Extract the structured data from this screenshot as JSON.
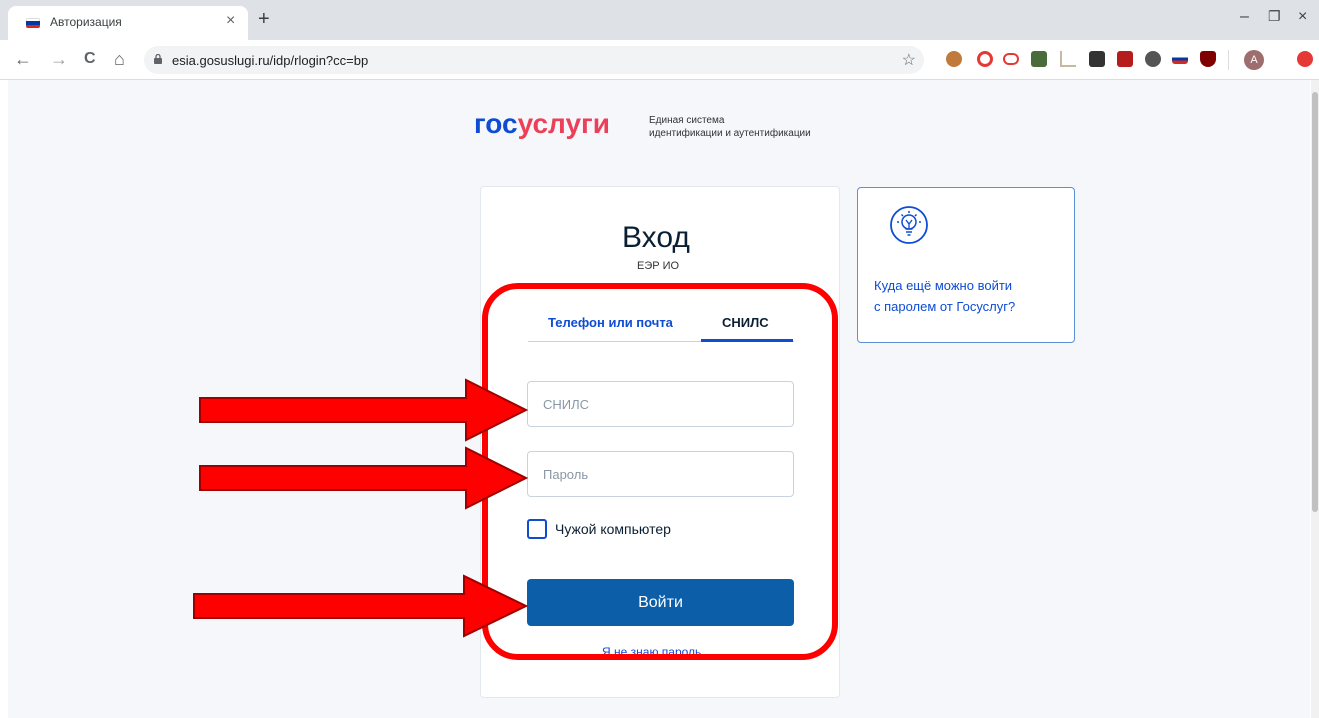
{
  "browser": {
    "tab_title": "Авторизация",
    "tab_close": "×",
    "new_tab": "+",
    "url": "esia.gosuslugi.ru/idp/rlogin?cc=bp",
    "minimize": "–",
    "restore": "❐",
    "close": "×",
    "back": "←",
    "forward": "→",
    "reload": "C",
    "home": "⌂",
    "star": "☆",
    "profile_initial": "A"
  },
  "header": {
    "logo_part1": "гос",
    "logo_part2": "услуги",
    "tagline_line1": "Единая система",
    "tagline_line2": "идентификации и аутентификации"
  },
  "login": {
    "title": "Вход",
    "subtitle": "ЕЭР ИО",
    "tabs": [
      {
        "label": "Телефон или почта",
        "active": false
      },
      {
        "label": "СНИЛС",
        "active": true
      }
    ],
    "snils_placeholder": "СНИЛС",
    "password_placeholder": "Пароль",
    "foreign_computer_label": "Чужой компьютер",
    "submit_label": "Войти",
    "forgot_label": "Я не знаю пароль"
  },
  "hint": {
    "text_line1": "Куда ещё можно войти",
    "text_line2": "с паролем от Госуслуг?"
  },
  "colors": {
    "brand_blue": "#0d4cd3",
    "brand_red": "#ee3f58",
    "button_blue": "#0d5ea8",
    "annotation_red": "#ff0000"
  }
}
